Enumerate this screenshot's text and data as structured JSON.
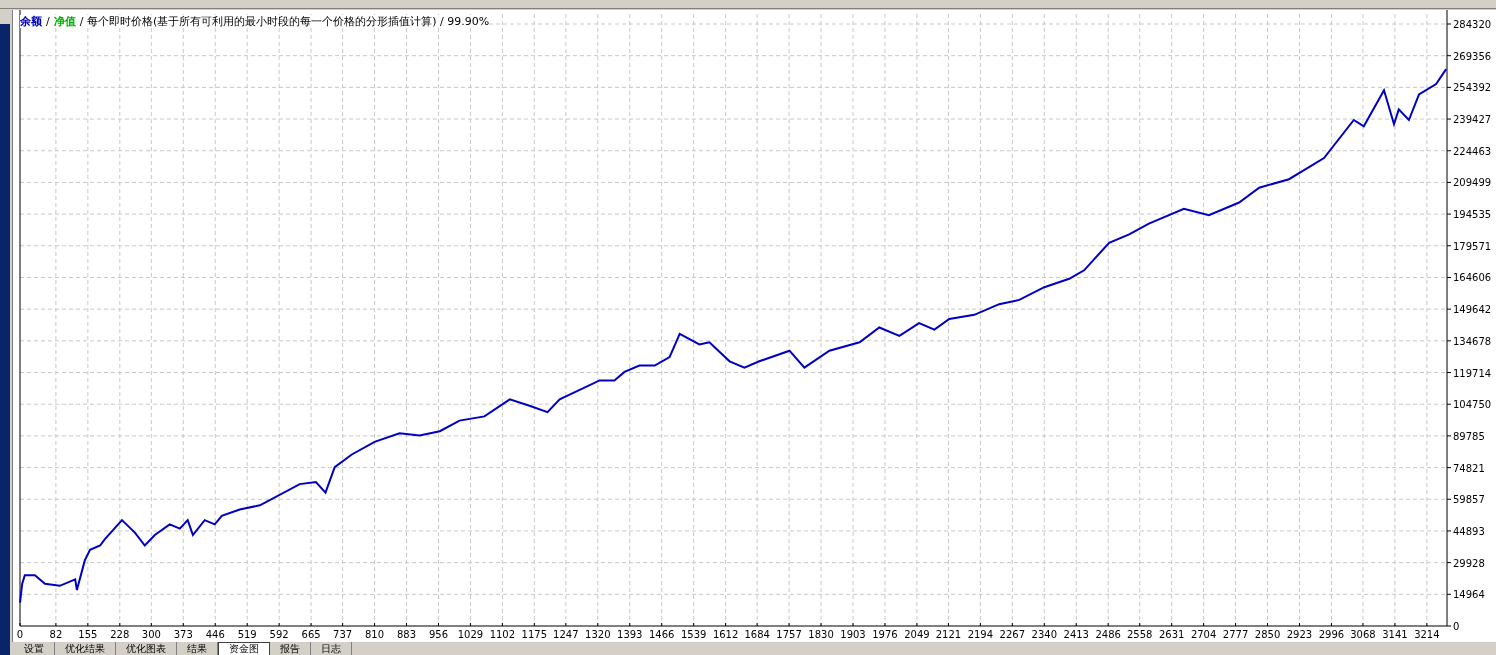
{
  "legend": [
    {
      "text": "/"
    },
    {
      "text": "净值",
      "color": "#00b000"
    },
    {
      "text": "/ 每个即时价格(基于所有可利用的最小时段的每一个价格的分形插值计算) / 99.90%"
    }
  ],
  "chart_data": {
    "type": "line",
    "grid": true,
    "x": [
      0,
      5,
      11,
      34,
      57,
      91,
      126,
      130,
      148,
      160,
      183,
      194,
      233,
      263,
      285,
      308,
      342,
      365,
      383,
      395,
      422,
      445,
      461,
      502,
      548,
      639,
      676,
      698,
      719,
      758,
      810,
      867,
      913,
      959,
      1004,
      1061,
      1119,
      1164,
      1205,
      1233,
      1324,
      1358,
      1381,
      1415,
      1450,
      1484,
      1507,
      1552,
      1575,
      1621,
      1655,
      1689,
      1758,
      1792,
      1849,
      1918,
      1963,
      2009,
      2054,
      2089,
      2123,
      2180,
      2237,
      2283,
      2340,
      2397,
      2431,
      2488,
      2534,
      2579,
      2659,
      2716,
      2785,
      2831,
      2899,
      2979,
      3047,
      3070,
      3116,
      3139,
      3150,
      3173,
      3196,
      3235,
      3258
    ],
    "series": [
      {
        "name": "余额",
        "color": "#0000c0",
        "values": [
          11000,
          20000,
          24000,
          24000,
          20000,
          19000,
          22000,
          17000,
          31000,
          36000,
          38000,
          41000,
          50000,
          44000,
          38000,
          43000,
          48000,
          46000,
          50000,
          43000,
          50000,
          48000,
          52000,
          55000,
          57000,
          67000,
          68000,
          63000,
          75000,
          81000,
          87000,
          91000,
          90000,
          92000,
          97000,
          99000,
          107000,
          104000,
          101000,
          107000,
          116000,
          116000,
          120000,
          123000,
          123000,
          127000,
          138000,
          133000,
          134000,
          125000,
          122000,
          125000,
          130000,
          122000,
          130000,
          134000,
          141000,
          137000,
          143000,
          140000,
          145000,
          147000,
          152000,
          154000,
          160000,
          164000,
          168000,
          181000,
          185000,
          190000,
          197000,
          194000,
          200000,
          207000,
          211000,
          221000,
          239000,
          236000,
          253000,
          237000,
          244000,
          239000,
          251000,
          256000,
          263000
        ]
      }
    ],
    "xticks": [
      0,
      82,
      155,
      228,
      300,
      373,
      446,
      519,
      592,
      665,
      737,
      810,
      883,
      956,
      1029,
      1102,
      1175,
      1247,
      1320,
      1393,
      1466,
      1539,
      1612,
      1684,
      1757,
      1830,
      1903,
      1976,
      2049,
      2121,
      2194,
      2267,
      2340,
      2413,
      2486,
      2558,
      2631,
      2704,
      2777,
      2850,
      2923,
      2996,
      3068,
      3141,
      3214
    ],
    "yticks": [
      0,
      14964,
      29928,
      44893,
      59857,
      74821,
      89785,
      104750,
      119714,
      134678,
      149642,
      164606,
      179571,
      194535,
      209499,
      224463,
      239427,
      254392,
      269356,
      284320
    ],
    "xlim": [
      0,
      3260
    ],
    "ylim": [
      0,
      284320
    ]
  },
  "tabs": [
    {
      "label": "设置",
      "selected": false
    },
    {
      "label": "优化结果",
      "selected": false
    },
    {
      "label": "优化图表",
      "selected": false
    },
    {
      "label": "结果",
      "selected": false
    },
    {
      "label": "资金图",
      "selected": true
    },
    {
      "label": "报告",
      "selected": false
    },
    {
      "label": "日志",
      "selected": false
    }
  ]
}
